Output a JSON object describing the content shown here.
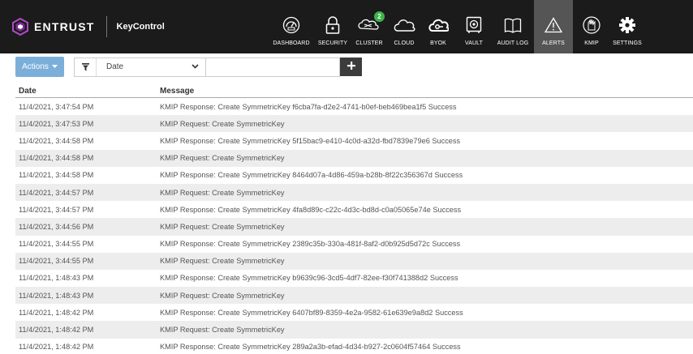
{
  "brand": {
    "name": "ENTRUST",
    "product": "KeyControl"
  },
  "nav": [
    {
      "label": "DASHBOARD",
      "icon": "dashboard-gauge-icon",
      "active": false,
      "width": 58
    },
    {
      "label": "SECURITY",
      "icon": "padlock-icon",
      "active": false,
      "width": 44
    },
    {
      "label": "CLUSTER",
      "icon": "cluster-nodes-icon",
      "active": false,
      "badge": "2",
      "width": 46
    },
    {
      "label": "CLOUD",
      "icon": "cloud-icon",
      "active": false,
      "width": 40
    },
    {
      "label": "BYOK",
      "icon": "byok-cloud-key-icon",
      "active": false,
      "width": 44
    },
    {
      "label": "VAULT",
      "icon": "vault-safe-icon",
      "active": false,
      "width": 44
    },
    {
      "label": "AUDIT LOG",
      "icon": "audit-log-book-icon",
      "active": false,
      "width": 52
    },
    {
      "label": "ALERTS",
      "icon": "alert-triangle-icon",
      "active": true,
      "width": 48
    },
    {
      "label": "KMIP",
      "icon": "kmip-shield-icon",
      "active": false,
      "width": 46
    },
    {
      "label": "SETTINGS",
      "icon": "gear-icon",
      "active": false,
      "width": 42
    }
  ],
  "toolbar": {
    "actions_label": "Actions",
    "filter_field": "Date",
    "filter_value": ""
  },
  "table": {
    "columns": [
      "Date",
      "Message"
    ],
    "rows": [
      {
        "date": "11/4/2021, 3:47:54 PM",
        "message": "KMIP Response: Create SymmetricKey f6cba7fa-d2e2-4741-b0ef-beb469bea1f5 Success"
      },
      {
        "date": "11/4/2021, 3:47:53 PM",
        "message": "KMIP Request: Create SymmetricKey"
      },
      {
        "date": "11/4/2021, 3:44:58 PM",
        "message": "KMIP Response: Create SymmetricKey 5f15bac9-e410-4c0d-a32d-fbd7839e79e6 Success"
      },
      {
        "date": "11/4/2021, 3:44:58 PM",
        "message": "KMIP Request: Create SymmetricKey"
      },
      {
        "date": "11/4/2021, 3:44:58 PM",
        "message": "KMIP Response: Create SymmetricKey 8464d07a-4d86-459a-b28b-8f22c356367d Success"
      },
      {
        "date": "11/4/2021, 3:44:57 PM",
        "message": "KMIP Request: Create SymmetricKey"
      },
      {
        "date": "11/4/2021, 3:44:57 PM",
        "message": "KMIP Response: Create SymmetricKey 4fa8d89c-c22c-4d3c-bd8d-c0a05065e74e Success"
      },
      {
        "date": "11/4/2021, 3:44:56 PM",
        "message": "KMIP Request: Create SymmetricKey"
      },
      {
        "date": "11/4/2021, 3:44:55 PM",
        "message": "KMIP Response: Create SymmetricKey 2389c35b-330a-481f-8af2-d0b925d5d72c Success"
      },
      {
        "date": "11/4/2021, 3:44:55 PM",
        "message": "KMIP Request: Create SymmetricKey"
      },
      {
        "date": "11/4/2021, 1:48:43 PM",
        "message": "KMIP Response: Create SymmetricKey b9639c96-3cd5-4df7-82ee-f30f741388d2 Success"
      },
      {
        "date": "11/4/2021, 1:48:43 PM",
        "message": "KMIP Request: Create SymmetricKey"
      },
      {
        "date": "11/4/2021, 1:48:42 PM",
        "message": "KMIP Response: Create SymmetricKey 6407bf89-8359-4e2a-9582-61e639e9a8d2 Success"
      },
      {
        "date": "11/4/2021, 1:48:42 PM",
        "message": "KMIP Request: Create SymmetricKey"
      },
      {
        "date": "11/4/2021, 1:48:42 PM",
        "message": "KMIP Response: Create SymmetricKey 289a2a3b-efad-4d34-b927-2c0604f57464 Success"
      }
    ]
  },
  "colors": {
    "topbar_bg": "#1b1b1b",
    "active_nav_bg": "#555555",
    "actions_btn": "#7bafd9",
    "badge_green": "#3db34a",
    "brand_purple": "#7a2e8e",
    "row_alt": "#ededed"
  }
}
